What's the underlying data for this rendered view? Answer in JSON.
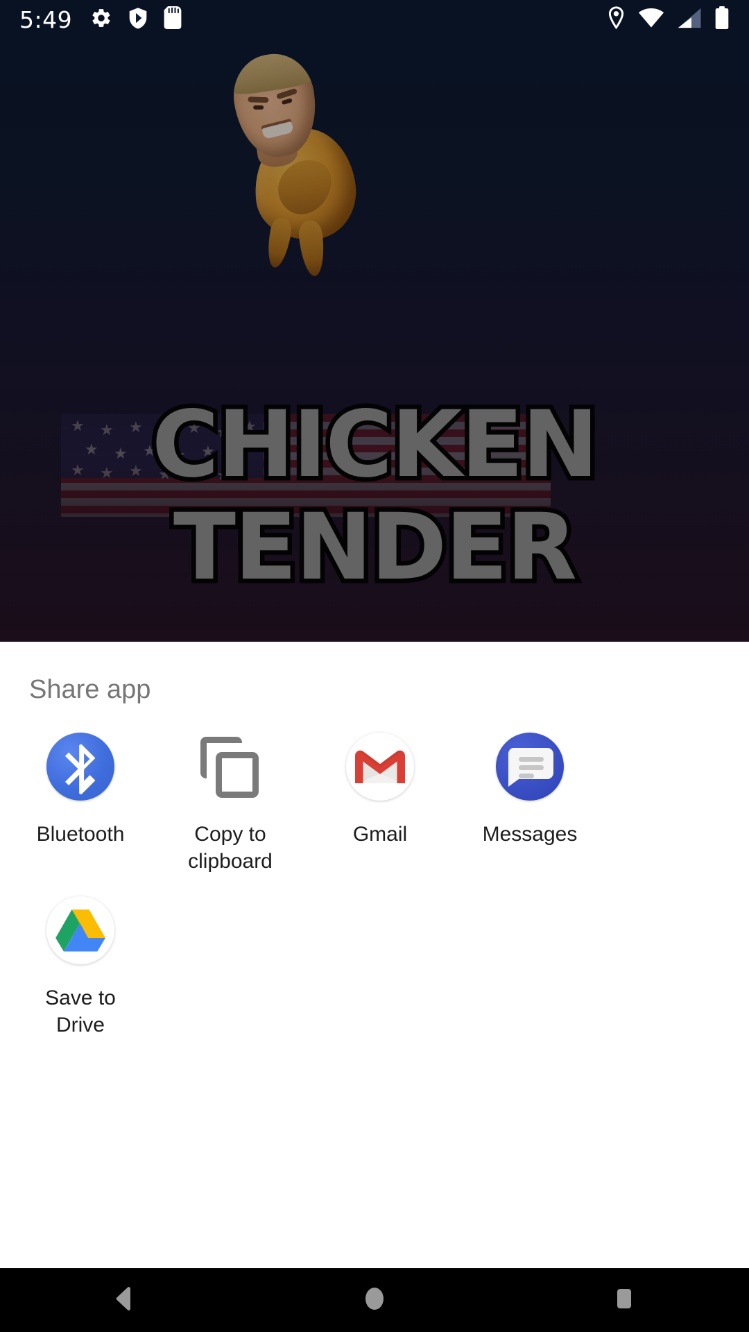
{
  "status_bar": {
    "clock": "5:49",
    "left_icons": [
      "settings-gear-icon",
      "play-protect-icon",
      "sd-card-icon"
    ],
    "right_icons": [
      "location-pin-icon",
      "wifi-icon",
      "cellular-signal-icon",
      "battery-icon"
    ],
    "background_color": "#0c1a33",
    "foreground_color": "#ffffff"
  },
  "background_app": {
    "wordmark_line1": "CHICKEN",
    "wordmark_line2": "TENDER",
    "wordmark_fill": "#8f8f8f",
    "wordmark_stroke": "#050505",
    "gradient_top": "#0c1a33",
    "gradient_bottom": "#3d0707",
    "artwork": "trump-chicken-meme"
  },
  "share_sheet": {
    "title": "Share app",
    "title_color": "#767676",
    "sheet_background": "#ffffff",
    "targets": [
      {
        "label": "Bluetooth",
        "icon": "bluetooth-icon",
        "color": "#3f6ddc"
      },
      {
        "label": "Copy to\nclipboard",
        "icon": "copy-clipboard-icon",
        "color": "#7a7a7a"
      },
      {
        "label": "Gmail",
        "icon": "gmail-icon",
        "color": "#d93025"
      },
      {
        "label": "Messages",
        "icon": "messages-icon",
        "color": "#3a4fc4"
      },
      {
        "label": "Save to Drive",
        "icon": "google-drive-icon",
        "color": "#fbbc04"
      }
    ]
  },
  "nav_bar": {
    "background_color": "#000000",
    "icon_color": "#9a9a9a",
    "buttons": [
      {
        "name": "back",
        "icon": "back-triangle-icon"
      },
      {
        "name": "home",
        "icon": "home-circle-icon"
      },
      {
        "name": "recents",
        "icon": "recents-square-icon"
      }
    ]
  }
}
